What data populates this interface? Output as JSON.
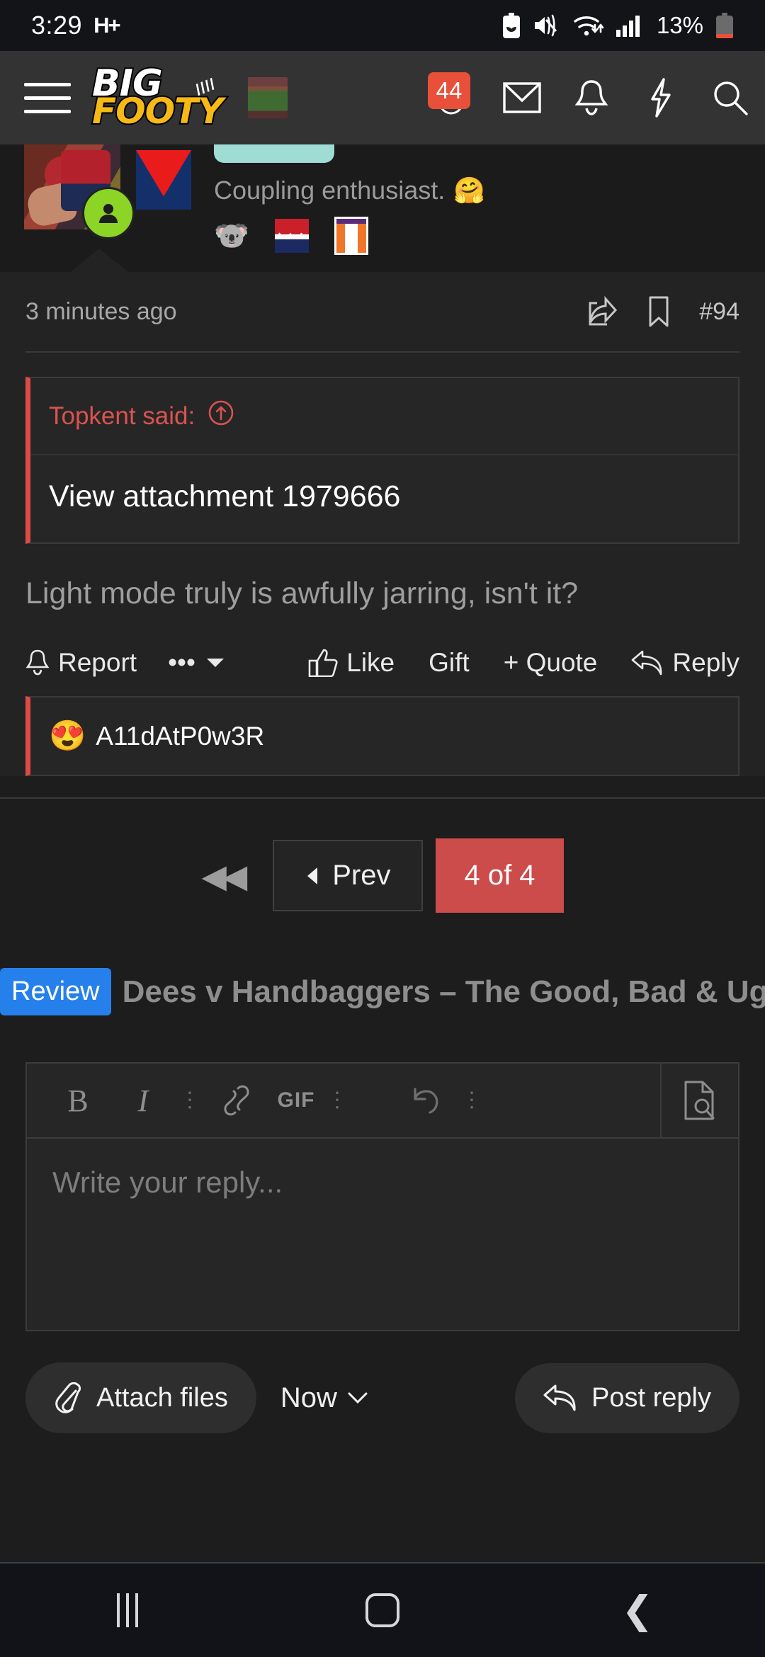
{
  "status_bar": {
    "time": "3:29",
    "network_type": "H+",
    "battery_percent": "13%",
    "icons": [
      "battery-saver-icon",
      "mute-vibrate-icon",
      "wifi-icon",
      "signal-bars-icon",
      "battery-icon"
    ]
  },
  "header": {
    "menu_icon": "hamburger-menu-icon",
    "logo_line1": "BIG",
    "logo_line2": "FOOTY",
    "thumbnail": "thread-thumbnail",
    "alerts_badge": "44",
    "icons": [
      "inbox-envelope-icon",
      "alerts-bell-icon",
      "whats-new-lightning-icon",
      "search-icon"
    ]
  },
  "profile_card": {
    "tagline": "Coupling enthusiast.",
    "tagline_emoji": "🤗",
    "badge_emoji": "🐨",
    "online_status": "online"
  },
  "post": {
    "timestamp": "3 minutes ago",
    "share_icon": "share-icon",
    "bookmark_icon": "bookmark-icon",
    "post_number": "#94",
    "quote": {
      "author_line": "Topkent said:",
      "jump_icon": "jump-to-post-icon",
      "body": "View attachment 1979666"
    },
    "body": "Light mode truly is awfully jarring, isn't it?",
    "actions": {
      "report": "Report",
      "more": "•••",
      "like": "Like",
      "gift": "Gift",
      "quote": "+ Quote",
      "reply": "Reply"
    },
    "reactions": {
      "emoji": "😍",
      "users": "A11dAtP0w3R"
    }
  },
  "pagination": {
    "first_label": "◀◀",
    "prev_label": "Prev",
    "current_label": "4 of 4"
  },
  "thread": {
    "prefix": "Review",
    "title": "Dees v Handbaggers – The Good, Bad & Ugly"
  },
  "editor": {
    "toolbar": {
      "bold": "B",
      "italic": "I",
      "more1": "⋮",
      "link": "link-icon",
      "gif": "GIF",
      "more2": "⋮",
      "undo": "undo-icon",
      "more3": "⋮",
      "preview": "preview-icon"
    },
    "placeholder": "Write your reply..."
  },
  "footer": {
    "attach_label": "Attach files",
    "time_label": "Now",
    "post_label": "Post reply"
  },
  "navbar": {
    "recents": "recents-icon",
    "home": "home-icon",
    "back": "back-icon"
  },
  "colors": {
    "accent_red": "#cc4b4b",
    "quote_bar": "#e04a45",
    "prefix_blue": "#2680eb",
    "badge_red": "#e8503a",
    "header_bg": "#333333",
    "post_bg": "#232323",
    "page_bg": "#1d1d1d"
  }
}
